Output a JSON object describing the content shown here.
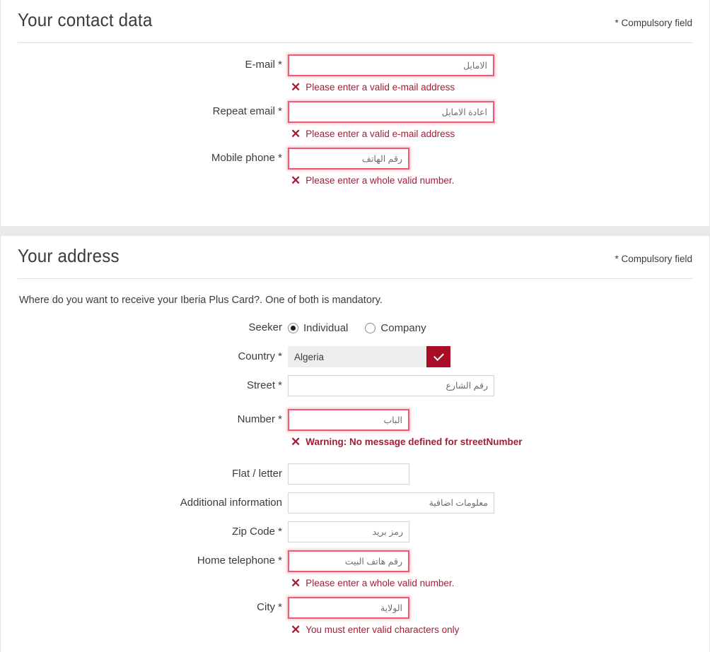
{
  "contact_section": {
    "title": "Your contact data",
    "compulsory_note": "* Compulsory field",
    "fields": {
      "email": {
        "label": "E-mail *",
        "placeholder": "الامايل",
        "error": "Please enter a valid e-mail address"
      },
      "repeat_email": {
        "label": "Repeat email *",
        "placeholder": "اعادة الامايل",
        "error": "Please enter a valid e-mail address"
      },
      "mobile_phone": {
        "label": "Mobile phone *",
        "placeholder": "رقم الهاتف",
        "error": "Please enter a whole valid number."
      }
    }
  },
  "address_section": {
    "title": "Your address",
    "compulsory_note": "* Compulsory field",
    "intro": "Where do you want to receive your Iberia Plus Card?. One of both is mandatory.",
    "seeker": {
      "label": "Seeker",
      "options": [
        {
          "label": "Individual",
          "selected": true
        },
        {
          "label": "Company",
          "selected": false
        }
      ]
    },
    "fields": {
      "country": {
        "label": "Country *",
        "value": "Algeria",
        "icon": "chevron-down-icon"
      },
      "street": {
        "label": "Street *",
        "placeholder": "رقم الشارع"
      },
      "number": {
        "label": "Number *",
        "placeholder": "الباب",
        "error": "Warning: No message defined for streetNumber"
      },
      "flat": {
        "label": "Flat / letter",
        "placeholder": ""
      },
      "additional_information": {
        "label": "Additional information",
        "placeholder": "معلومات اضافية"
      },
      "zip_code": {
        "label": "Zip Code *",
        "placeholder": "رمز بريد"
      },
      "home_telephone": {
        "label": "Home telephone *",
        "placeholder": "رقم هاتف البيت",
        "error": "Please enter a whole valid number."
      },
      "city": {
        "label": "City *",
        "placeholder": "الولاية",
        "error": "You must enter valid characters only"
      }
    }
  },
  "icons": {
    "error": "✕"
  },
  "colors": {
    "error_text": "#a81b35",
    "error_border": "#eb5c72",
    "brand_red": "#a80c26",
    "select_bg": "#eeeeee",
    "band": "#e9e9e9"
  }
}
